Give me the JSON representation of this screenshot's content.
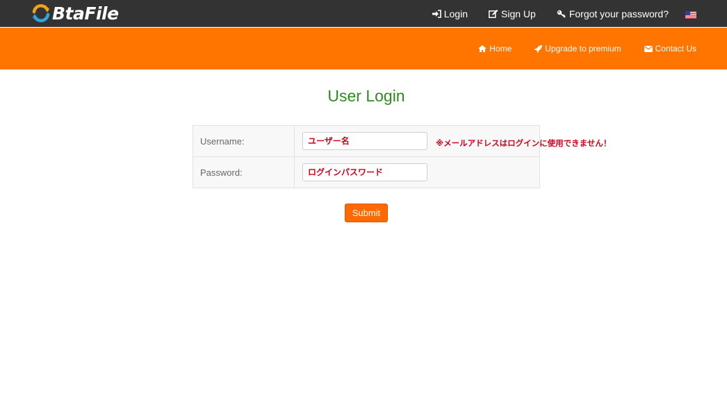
{
  "brand": {
    "name": "BtaFile"
  },
  "topnav": {
    "login": "Login",
    "signup": "Sign Up",
    "forgot": "Forgot your password?"
  },
  "subnav": {
    "home": "Home",
    "upgrade": "Upgrade to premium",
    "contact": "Contact Us"
  },
  "login": {
    "title": "User Login",
    "username_label": "Username:",
    "username_placeholder": "ユーザー名",
    "username_hint": "※メールアドレスはログインに使用できません！",
    "password_label": "Password:",
    "password_placeholder": "ログインパスワード",
    "submit": "Submit"
  },
  "colors": {
    "topbar": "#333333",
    "accent_orange": "#ff7500",
    "title_green": "#2e8b1f",
    "error_red": "#d0021b"
  },
  "icons": [
    "refresh-logo-icon",
    "sign-in-icon",
    "edit-icon",
    "key-icon",
    "us-flag-icon",
    "home-icon",
    "rocket-icon",
    "envelope-icon"
  ]
}
